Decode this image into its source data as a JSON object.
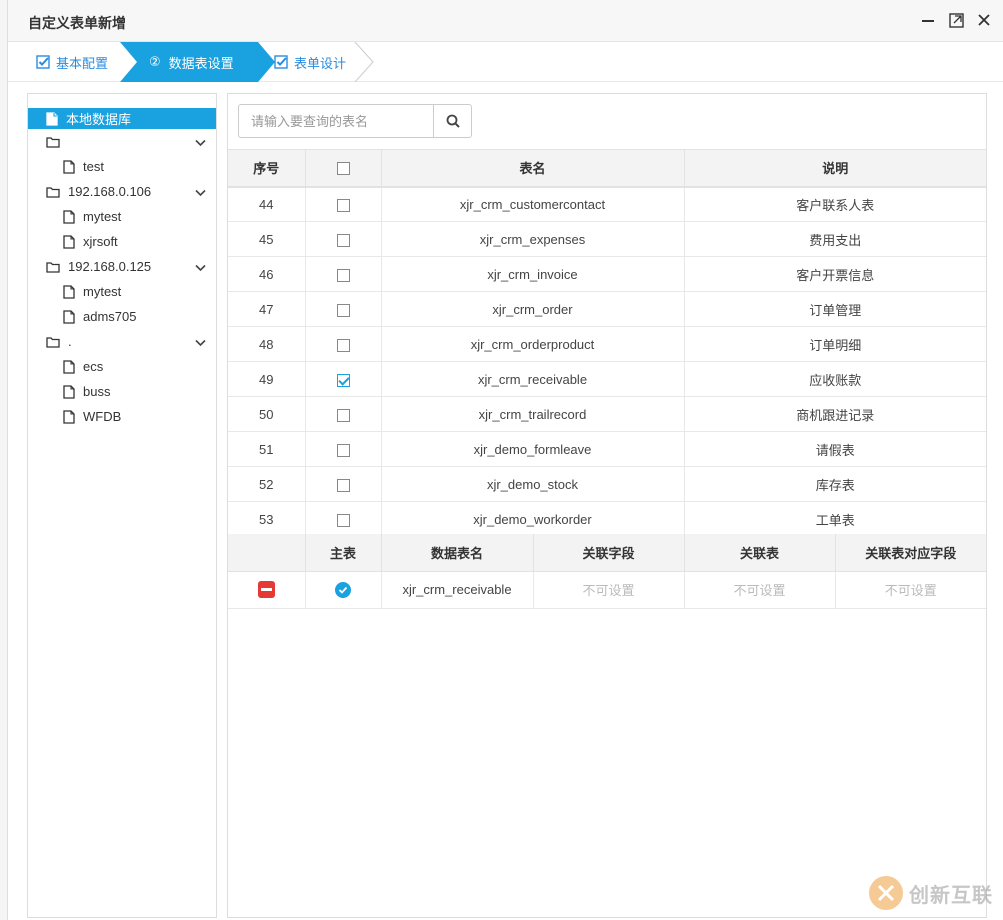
{
  "window": {
    "title": "自定义表单新增"
  },
  "steps": [
    {
      "label": "基本配置",
      "state": "done"
    },
    {
      "label": "数据表设置",
      "number": "②",
      "state": "active"
    },
    {
      "label": "表单设计",
      "state": "done"
    }
  ],
  "tree": {
    "items": [
      {
        "label": "本地数据库",
        "level": 0,
        "selected": true
      },
      {
        "label": "",
        "level": 0,
        "type": "folder",
        "expandable": true
      },
      {
        "label": "test",
        "level": 1
      },
      {
        "label": "192.168.0.106",
        "level": 0,
        "type": "folder",
        "expandable": true
      },
      {
        "label": "mytest",
        "level": 1
      },
      {
        "label": "xjrsoft",
        "level": 1
      },
      {
        "label": "192.168.0.125",
        "level": 0,
        "type": "folder",
        "expandable": true
      },
      {
        "label": "mytest",
        "level": 1
      },
      {
        "label": "adms705",
        "level": 1
      },
      {
        "label": ".",
        "level": 0,
        "type": "folder",
        "expandable": true
      },
      {
        "label": "ecs",
        "level": 1
      },
      {
        "label": "buss",
        "level": 1
      },
      {
        "label": "WFDB",
        "level": 1
      }
    ]
  },
  "search": {
    "placeholder": "请输入要查询的表名"
  },
  "table": {
    "headers": {
      "index": "序号",
      "name": "表名",
      "desc": "说明"
    },
    "rows": [
      {
        "index": "44",
        "name": "xjr_crm_customercontact",
        "desc": "客户联系人表",
        "checked": false
      },
      {
        "index": "45",
        "name": "xjr_crm_expenses",
        "desc": "费用支出",
        "checked": false
      },
      {
        "index": "46",
        "name": "xjr_crm_invoice",
        "desc": "客户开票信息",
        "checked": false
      },
      {
        "index": "47",
        "name": "xjr_crm_order",
        "desc": "订单管理",
        "checked": false
      },
      {
        "index": "48",
        "name": "xjr_crm_orderproduct",
        "desc": "订单明细",
        "checked": false
      },
      {
        "index": "49",
        "name": "xjr_crm_receivable",
        "desc": "应收账款",
        "checked": true
      },
      {
        "index": "50",
        "name": "xjr_crm_trailrecord",
        "desc": "商机跟进记录",
        "checked": false
      },
      {
        "index": "51",
        "name": "xjr_demo_formleave",
        "desc": "请假表",
        "checked": false
      },
      {
        "index": "52",
        "name": "xjr_demo_stock",
        "desc": "库存表",
        "checked": false
      },
      {
        "index": "53",
        "name": "xjr_demo_workorder",
        "desc": "工单表",
        "checked": false
      }
    ]
  },
  "relation_table": {
    "headers": {
      "main": "主表",
      "table_name": "数据表名",
      "rel_field": "关联字段",
      "rel_table": "关联表",
      "rel_target_field": "关联表对应字段"
    },
    "rows": [
      {
        "table_name": "xjr_crm_receivable",
        "rel_field": "不可设置",
        "rel_table": "不可设置",
        "rel_target_field": "不可设置",
        "is_main": true
      }
    ]
  },
  "watermark": {
    "text": "创新互联"
  },
  "colors": {
    "accent": "#1aa1e0",
    "danger": "#e53935"
  }
}
